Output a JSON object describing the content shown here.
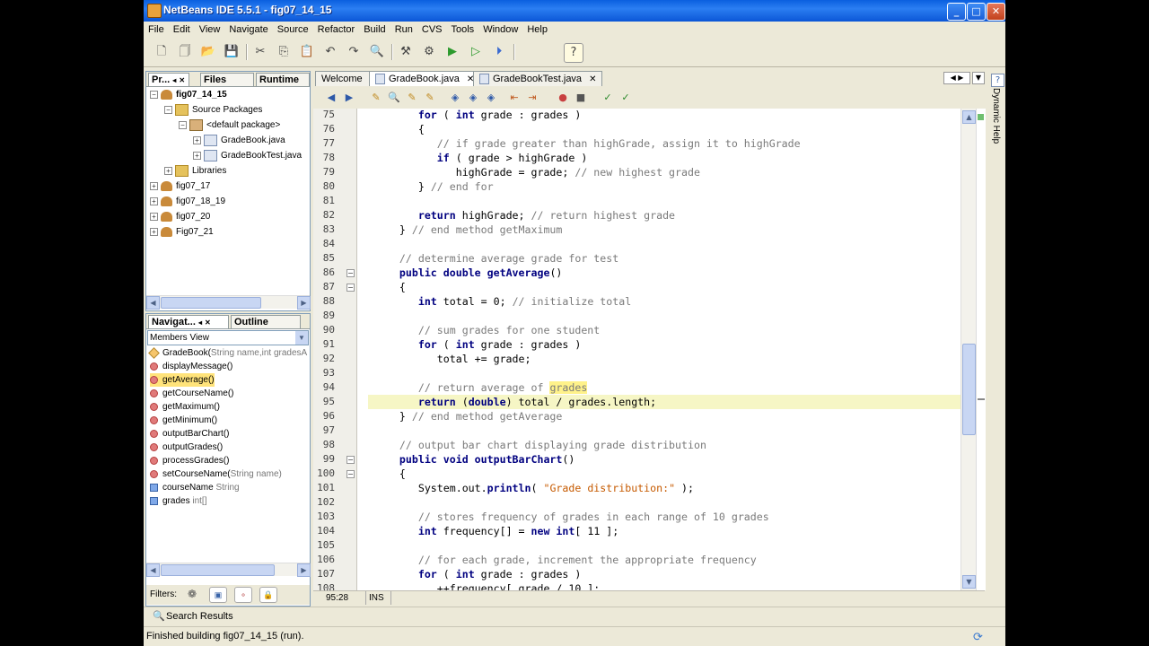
{
  "window": {
    "title": "NetBeans IDE 5.5.1 - fig07_14_15",
    "minimize": "_",
    "maximize": "□",
    "close": "✕"
  },
  "menubar": [
    "File",
    "Edit",
    "View",
    "Navigate",
    "Source",
    "Refactor",
    "Build",
    "Run",
    "CVS",
    "Tools",
    "Window",
    "Help"
  ],
  "projects_panel": {
    "tabs": [
      "Pr...",
      "Files",
      "Runtime"
    ],
    "tree": [
      {
        "label": "fig07_14_15",
        "level": 0,
        "icon": "project-icon",
        "exp": "−"
      },
      {
        "label": "Source Packages",
        "level": 1,
        "icon": "folder-icon",
        "exp": "−"
      },
      {
        "label": "<default package>",
        "level": 2,
        "icon": "package-icon",
        "exp": "−"
      },
      {
        "label": "GradeBook.java",
        "level": 3,
        "icon": "java-file-icon",
        "exp": "+"
      },
      {
        "label": "GradeBookTest.java",
        "level": 3,
        "icon": "java-file-icon",
        "exp": "+"
      },
      {
        "label": "Libraries",
        "level": 1,
        "icon": "folder-icon",
        "exp": "+"
      },
      {
        "label": "fig07_17",
        "level": 0,
        "icon": "project-icon",
        "exp": "+"
      },
      {
        "label": "fig07_18_19",
        "level": 0,
        "icon": "project-icon",
        "exp": "+"
      },
      {
        "label": "fig07_20",
        "level": 0,
        "icon": "project-icon",
        "exp": "+"
      },
      {
        "label": "Fig07_21",
        "level": 0,
        "icon": "project-icon",
        "exp": "+"
      }
    ]
  },
  "navigator_panel": {
    "tabs": [
      "Navigat...",
      "Outline"
    ],
    "view_select": "Members View",
    "members": [
      {
        "name": "GradeBook(",
        "detail": "String name,int gradesA",
        "kind": "constructor"
      },
      {
        "name": "displayMessage()",
        "detail": "",
        "kind": "method"
      },
      {
        "name": "getAverage()",
        "detail": "",
        "kind": "method",
        "selected": true
      },
      {
        "name": "getCourseName()",
        "detail": "",
        "kind": "method"
      },
      {
        "name": "getMaximum()",
        "detail": "",
        "kind": "method"
      },
      {
        "name": "getMinimum()",
        "detail": "",
        "kind": "method"
      },
      {
        "name": "outputBarChart()",
        "detail": "",
        "kind": "method"
      },
      {
        "name": "outputGrades()",
        "detail": "",
        "kind": "method"
      },
      {
        "name": "processGrades()",
        "detail": "",
        "kind": "method"
      },
      {
        "name": "setCourseName(",
        "detail": "String name)",
        "kind": "method"
      },
      {
        "name": "courseName ",
        "detail": "String",
        "kind": "field"
      },
      {
        "name": "grades ",
        "detail": "int[]",
        "kind": "field"
      }
    ],
    "filters_label": "Filters:"
  },
  "editor": {
    "tabs": [
      {
        "label": "Welcome",
        "active": false,
        "close": false
      },
      {
        "label": "GradeBook.java",
        "active": true,
        "close": true
      },
      {
        "label": "GradeBookTest.java",
        "active": false,
        "close": true
      }
    ],
    "lines": [
      {
        "n": "75",
        "segs": [
          [
            "",
            "        "
          ],
          [
            "kw",
            "for"
          ],
          [
            "",
            " ( "
          ],
          [
            "kw",
            "int"
          ],
          [
            "",
            " grade : grades )"
          ]
        ]
      },
      {
        "n": "76",
        "segs": [
          [
            "",
            "        {"
          ]
        ]
      },
      {
        "n": "77",
        "segs": [
          [
            "",
            "           "
          ],
          [
            "cm",
            "// if grade greater than highGrade, assign it to highGrade"
          ]
        ]
      },
      {
        "n": "78",
        "segs": [
          [
            "",
            "           "
          ],
          [
            "kw",
            "if"
          ],
          [
            "",
            " ( grade > highGrade )"
          ]
        ]
      },
      {
        "n": "79",
        "segs": [
          [
            "",
            "              highGrade = grade; "
          ],
          [
            "cm",
            "// new highest grade"
          ]
        ]
      },
      {
        "n": "80",
        "segs": [
          [
            "",
            "        } "
          ],
          [
            "cm",
            "// end for"
          ]
        ]
      },
      {
        "n": "81",
        "segs": [
          [
            "",
            ""
          ]
        ]
      },
      {
        "n": "82",
        "segs": [
          [
            "",
            "        "
          ],
          [
            "kw",
            "return"
          ],
          [
            "",
            " highGrade; "
          ],
          [
            "cm",
            "// return highest grade"
          ]
        ]
      },
      {
        "n": "83",
        "segs": [
          [
            "",
            "     } "
          ],
          [
            "cm",
            "// end method getMaximum"
          ]
        ]
      },
      {
        "n": "84",
        "segs": [
          [
            "",
            ""
          ]
        ]
      },
      {
        "n": "85",
        "segs": [
          [
            "",
            "     "
          ],
          [
            "cm",
            "// determine average grade for test"
          ]
        ]
      },
      {
        "n": "86",
        "segs": [
          [
            "",
            "     "
          ],
          [
            "kw",
            "public double"
          ],
          [
            "",
            " "
          ],
          [
            "kw",
            "getAverage"
          ],
          [
            "",
            "()"
          ]
        ],
        "fold": true
      },
      {
        "n": "87",
        "segs": [
          [
            "",
            "     {"
          ]
        ],
        "fold": true
      },
      {
        "n": "88",
        "segs": [
          [
            "",
            "        "
          ],
          [
            "kw",
            "int"
          ],
          [
            "",
            " total = 0; "
          ],
          [
            "cm",
            "// initialize total"
          ]
        ]
      },
      {
        "n": "89",
        "segs": [
          [
            "",
            ""
          ]
        ]
      },
      {
        "n": "90",
        "segs": [
          [
            "",
            "        "
          ],
          [
            "cm",
            "// sum grades for one student"
          ]
        ]
      },
      {
        "n": "91",
        "segs": [
          [
            "",
            "        "
          ],
          [
            "kw",
            "for"
          ],
          [
            "",
            " ( "
          ],
          [
            "kw",
            "int"
          ],
          [
            "",
            " grade : grades )"
          ]
        ]
      },
      {
        "n": "92",
        "segs": [
          [
            "",
            "           total += grade;"
          ]
        ]
      },
      {
        "n": "93",
        "segs": [
          [
            "",
            ""
          ]
        ]
      },
      {
        "n": "94",
        "segs": [
          [
            "",
            "        "
          ],
          [
            "cm",
            "// return average of "
          ],
          [
            "cm hi",
            "grades"
          ]
        ]
      },
      {
        "n": "95",
        "segs": [
          [
            "",
            "        "
          ],
          [
            "kw",
            "return"
          ],
          [
            "",
            " ("
          ],
          [
            "kw",
            "double"
          ],
          [
            "",
            ") total / grades.length;"
          ]
        ],
        "hl": true
      },
      {
        "n": "96",
        "segs": [
          [
            "",
            "     } "
          ],
          [
            "cm",
            "// end method getAverage"
          ]
        ]
      },
      {
        "n": "97",
        "segs": [
          [
            "",
            ""
          ]
        ]
      },
      {
        "n": "98",
        "segs": [
          [
            "",
            "     "
          ],
          [
            "cm",
            "// output bar chart displaying grade distribution"
          ]
        ]
      },
      {
        "n": "99",
        "segs": [
          [
            "",
            "     "
          ],
          [
            "kw",
            "public void"
          ],
          [
            "",
            " "
          ],
          [
            "kw",
            "outputBarChart"
          ],
          [
            "",
            "()"
          ]
        ],
        "fold": true
      },
      {
        "n": "100",
        "segs": [
          [
            "",
            "     {"
          ]
        ],
        "fold": true
      },
      {
        "n": "101",
        "segs": [
          [
            "",
            "        System.out."
          ],
          [
            "kw",
            "println"
          ],
          [
            "",
            "( "
          ],
          [
            "st",
            "\"Grade distribution:\""
          ],
          [
            "",
            " );"
          ]
        ]
      },
      {
        "n": "102",
        "segs": [
          [
            "",
            ""
          ]
        ]
      },
      {
        "n": "103",
        "segs": [
          [
            "",
            "        "
          ],
          [
            "cm",
            "// stores frequency of grades in each range of 10 grades"
          ]
        ]
      },
      {
        "n": "104",
        "segs": [
          [
            "",
            "        "
          ],
          [
            "kw",
            "int"
          ],
          [
            "",
            " frequency[] = "
          ],
          [
            "kw",
            "new int"
          ],
          [
            "",
            "[ 11 ];"
          ]
        ]
      },
      {
        "n": "105",
        "segs": [
          [
            "",
            ""
          ]
        ]
      },
      {
        "n": "106",
        "segs": [
          [
            "",
            "        "
          ],
          [
            "cm",
            "// for each grade, increment the appropriate frequency"
          ]
        ]
      },
      {
        "n": "107",
        "segs": [
          [
            "",
            "        "
          ],
          [
            "kw",
            "for"
          ],
          [
            "",
            " ( "
          ],
          [
            "kw",
            "int"
          ],
          [
            "",
            " grade : grades )"
          ]
        ]
      },
      {
        "n": "108",
        "segs": [
          [
            "",
            "           ++frequency[ grade / 10 ];"
          ]
        ]
      }
    ],
    "cursor_position": "95:28",
    "insert_mode": "INS"
  },
  "dynamic_help": {
    "label": "Dynamic Help",
    "icon": "?"
  },
  "search_results_label": "Search Results",
  "status_text": "Finished building fig07_14_15 (run).",
  "colors": {
    "titlebar": "#0a5fdf",
    "keyword": "#000080",
    "comment": "#7a7a7a",
    "string": "#c65a00",
    "selection": "#ffe37a"
  }
}
